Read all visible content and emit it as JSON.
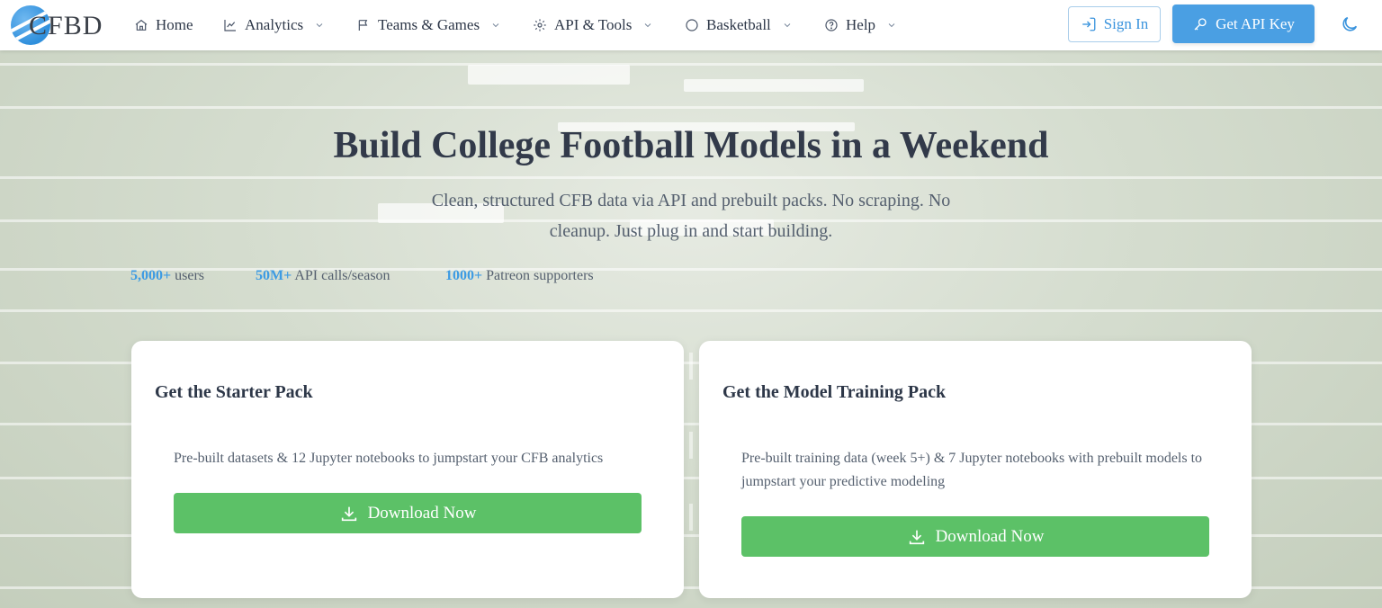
{
  "brand": {
    "name": "CFBD"
  },
  "nav": {
    "items": [
      {
        "label": "Home",
        "icon": "home-icon",
        "has_dropdown": false
      },
      {
        "label": "Analytics",
        "icon": "chart-line-icon",
        "has_dropdown": true
      },
      {
        "label": "Teams & Games",
        "icon": "flag-icon",
        "has_dropdown": true
      },
      {
        "label": "API & Tools",
        "icon": "gear-icon",
        "has_dropdown": true
      },
      {
        "label": "Basketball",
        "icon": "circle-icon",
        "has_dropdown": true
      },
      {
        "label": "Help",
        "icon": "help-circle-icon",
        "has_dropdown": true
      }
    ],
    "sign_in": "Sign In",
    "get_api_key": "Get API Key",
    "theme_toggle_icon": "moon-icon"
  },
  "hero": {
    "title": "Build College Football Models in a Weekend",
    "subtitle": "Clean, structured CFB data via API and prebuilt packs. No scraping. No cleanup. Just plug in and start building.",
    "stats": [
      {
        "value": "5,000+",
        "label": "users"
      },
      {
        "value": "50M+",
        "label": "API calls/season"
      },
      {
        "value": "1000+",
        "label": "Patreon supporters"
      }
    ]
  },
  "cards": [
    {
      "title": "Get the Starter Pack",
      "description": "Pre-built datasets & 12 Jupyter notebooks to jumpstart your CFB analytics",
      "button": "Download Now"
    },
    {
      "title": "Get the Model Training Pack",
      "description": "Pre-built training data (week 5+) & 7 Jupyter notebooks with prebuilt models to jumpstart your predictive modeling",
      "button": "Download Now"
    }
  ],
  "colors": {
    "accent": "#4a9fe3",
    "download": "#5cc167",
    "stat_value": "#3d9be3"
  }
}
